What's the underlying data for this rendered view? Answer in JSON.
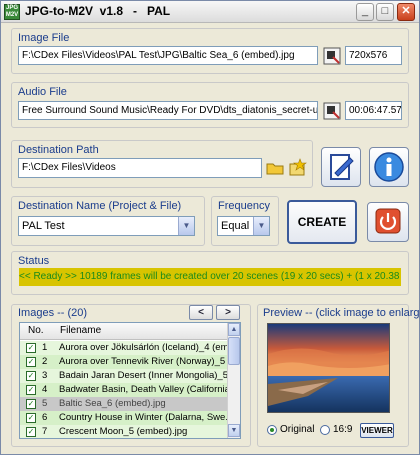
{
  "window": {
    "app_icon_text": "JPG M2V",
    "title": "JPG-to-M2V  v1.8   -   PAL",
    "minimize": "_",
    "maximize": "□",
    "close": "✕"
  },
  "image_file": {
    "label": "Image File",
    "path": "F:\\CDex Files\\Videos\\PAL Test\\JPG\\Baltic Sea_6 (embed).jpg",
    "resolution": "720x576"
  },
  "audio_file": {
    "label": "Audio File",
    "path": "Free Surround Sound Music\\Ready For DVD\\dts_diatonis_secret-universe.dts",
    "duration": "00:06:47.573"
  },
  "destination_path": {
    "label": "Destination Path",
    "path": "F:\\CDex Files\\Videos"
  },
  "destination_name": {
    "label": "Destination Name (Project & File)",
    "value": "PAL Test"
  },
  "frequency": {
    "label": "Frequency",
    "value": "Equal"
  },
  "create_button": "CREATE",
  "status": {
    "label": "Status",
    "text": "<< Ready >>  10189 frames will be created over 20 scenes (19 x 20 secs) + (1 x 20.38 secs)"
  },
  "images": {
    "label": "Images -- (20)",
    "prev": "<",
    "next": ">",
    "columns": [
      "No.",
      "Filename"
    ],
    "rows": [
      {
        "no": "1",
        "name": "Aurora over Jökulsárlón (Iceland)_4 (em...",
        "checked": true
      },
      {
        "no": "2",
        "name": "Aurora over Tennevik River (Norway)_5 ...",
        "checked": true
      },
      {
        "no": "3",
        "name": "Badain Jaran Desert (Inner Mongolia)_5 ...",
        "checked": true
      },
      {
        "no": "4",
        "name": "Badwater Basin, Death Valley (California...",
        "checked": true
      },
      {
        "no": "5",
        "name": "Baltic Sea_6 (embed).jpg",
        "checked": true
      },
      {
        "no": "6",
        "name": "Country House in Winter (Dalarna, Swe...",
        "checked": true
      },
      {
        "no": "7",
        "name": "Crescent Moon_5 (embed).jpg",
        "checked": true
      }
    ]
  },
  "preview": {
    "label": "Preview -- (click image to enlarge)",
    "option_original": "Original",
    "option_169": "16:9",
    "selected": "Original",
    "viewer_button": "VIEWER"
  }
}
